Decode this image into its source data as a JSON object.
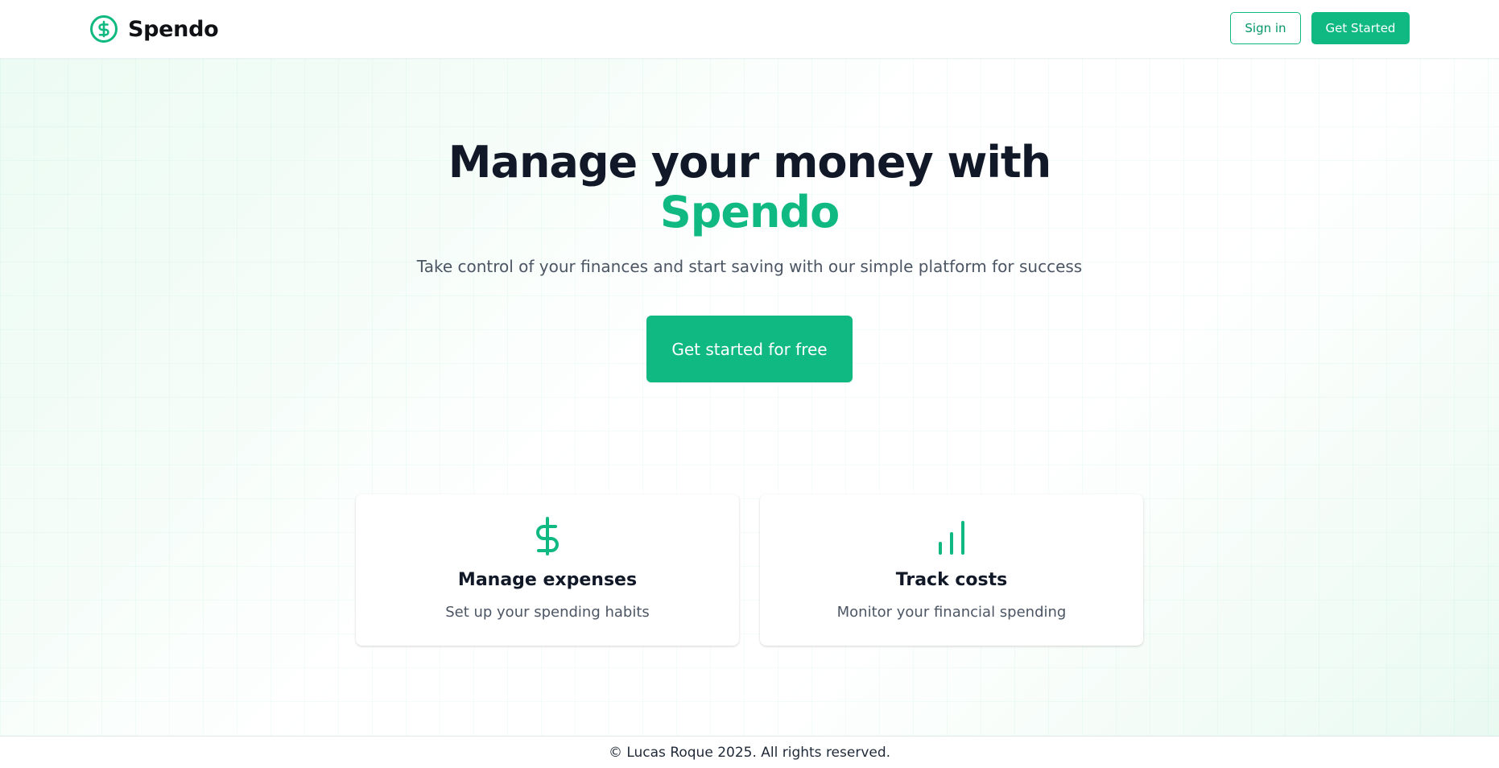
{
  "header": {
    "brand_name": "Spendo",
    "brand_icon": "dollar-circle-icon",
    "signin_label": "Sign in",
    "get_started_label": "Get Started"
  },
  "hero": {
    "title_line1": "Manage your money with",
    "title_line2": "Spendo",
    "subtitle": "Take control of your finances and start saving with our simple platform for success",
    "cta_label": "Get started for free"
  },
  "features": [
    {
      "icon": "dollar-icon",
      "title": "Manage expenses",
      "description": "Set up your spending habits"
    },
    {
      "icon": "bar-chart-icon",
      "title": "Track costs",
      "description": "Monitor your financial spending"
    }
  ],
  "footer": {
    "copyright": "© Lucas Roque 2025. All rights reserved."
  },
  "colors": {
    "accent": "#10b981",
    "heading": "#111827",
    "body_text": "#4b5563"
  }
}
